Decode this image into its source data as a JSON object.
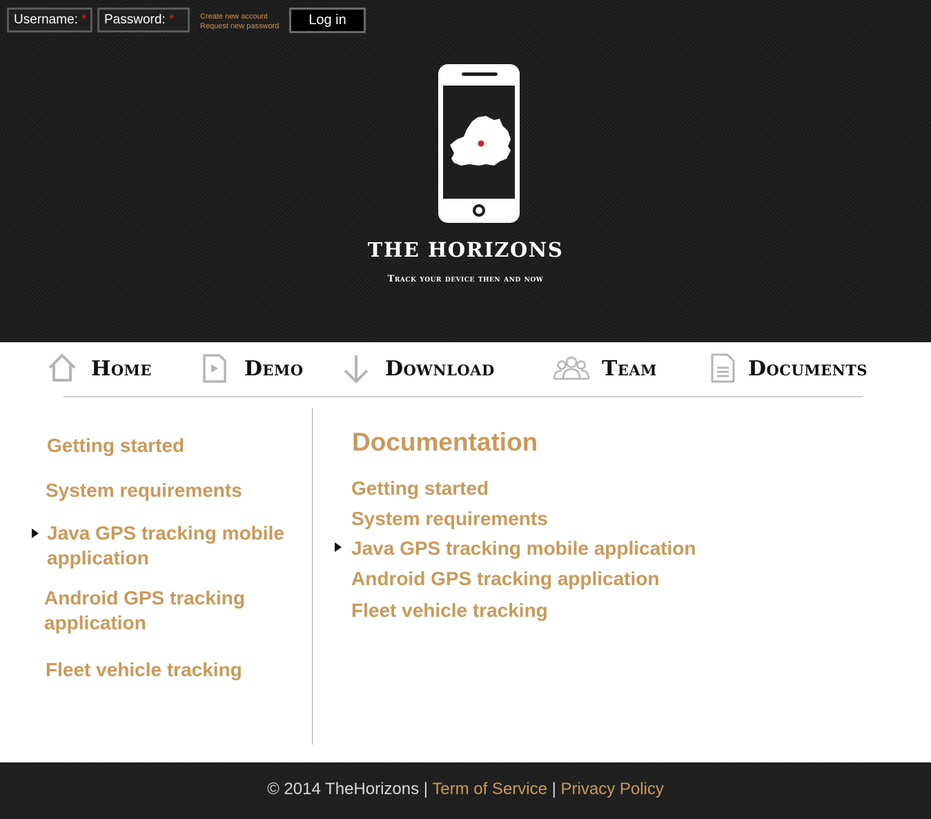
{
  "login": {
    "username_label": "Username:",
    "password_label": "Password:",
    "required_marker": "*",
    "create_account": "Create new account",
    "request_password": "Request new password",
    "login_button": "Log in"
  },
  "site": {
    "title": "THE HORIZONS",
    "tagline": "Track your device then and now"
  },
  "nav": {
    "items": [
      {
        "label": "Home",
        "icon": "home-icon"
      },
      {
        "label": "Demo",
        "icon": "play-document-icon"
      },
      {
        "label": "Download",
        "icon": "download-arrow-icon"
      },
      {
        "label": "Team",
        "icon": "team-people-icon"
      },
      {
        "label": "Documents",
        "icon": "document-icon"
      }
    ]
  },
  "sidebar": {
    "links": [
      {
        "line1": "Getting started",
        "line2": ""
      },
      {
        "line1": "System requirements",
        "line2": ""
      },
      {
        "line1": "Java GPS tracking mobile",
        "line2": "application"
      },
      {
        "line1": "Android GPS tracking",
        "line2": "application"
      },
      {
        "line1": "Fleet vehicle tracking",
        "line2": ""
      }
    ]
  },
  "main": {
    "title": "Documentation",
    "links": [
      "Getting started",
      "System requirements",
      "Java GPS tracking mobile application",
      "Android GPS tracking application",
      "Fleet vehicle tracking"
    ]
  },
  "footer": {
    "copyright": "© 2014 TheHorizons",
    "separator": "|",
    "terms": "Term of Service",
    "privacy": "Privacy Policy"
  },
  "colors": {
    "accent_gold": "#c99a5b",
    "header_bg": "#1e1e1e",
    "required_red": "#d0242b"
  }
}
